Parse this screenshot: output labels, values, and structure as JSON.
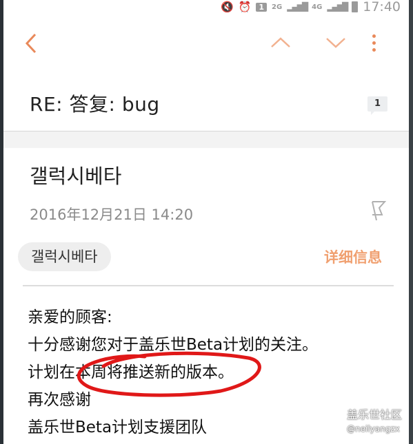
{
  "status_bar": {
    "time": "17:40",
    "network_1": "2G",
    "network_2": "4G",
    "notification_count": "1"
  },
  "toolbar": {
    "back_icon": "chevron-left-icon",
    "prev_icon": "chevron-up-icon",
    "next_icon": "chevron-down-icon",
    "more_icon": "more-vertical-icon"
  },
  "email": {
    "subject": "RE: 答复: bug",
    "thread_count": "1",
    "sender": "갤럭시베타",
    "date": "2016年12月21日  14:20",
    "recipient_chip": "갤럭시베타",
    "details_link": "详细信息",
    "body": [
      "亲爱的顾客:",
      "十分感谢您对于盖乐世Beta计划的关注。",
      "计划在本周将推送新的版本。",
      "再次感谢",
      "盖乐世Beta计划支援团队"
    ]
  },
  "watermark": {
    "line1": "盖乐世社区",
    "line2": "@neilyangzx"
  },
  "colors": {
    "accent": "#e9895a",
    "accent_light": "#f0a070",
    "annotation_circle": "#e01818"
  }
}
